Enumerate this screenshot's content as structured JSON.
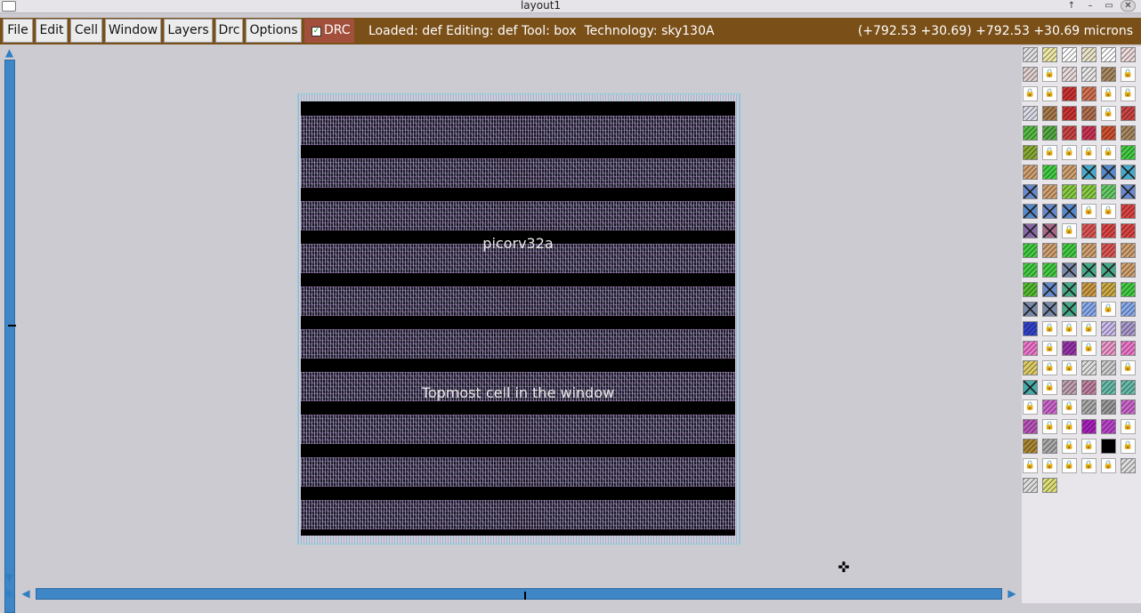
{
  "window": {
    "title": "layout1"
  },
  "menu": {
    "items": [
      "File",
      "Edit",
      "Cell",
      "Window",
      "Layers",
      "Drc",
      "Options"
    ],
    "drc_label": "DRC",
    "drc_checked": true
  },
  "status": {
    "text": "Loaded: def Editing: def Tool: box  Technology: sky130A",
    "coords": "(+792.53 +30.69) +792.53 +30.69 microns"
  },
  "canvas": {
    "cell_name": "picorv32a",
    "cell_caption": "Topmost cell in the window"
  },
  "colors": {
    "menubar": "#7a4f18",
    "drc": "#a24f3c",
    "scrollbar": "#3f86c6",
    "background": "#cdcbd2"
  },
  "layers_panel": {
    "rows": [
      [
        "#e0dfe2",
        "#eee8a6",
        "#ffffff",
        "#e8e2c8",
        "#ffffff",
        "#ecd8d8"
      ],
      [
        "#e0d0d0",
        "lock",
        "#e8dada",
        "#e6e6e6",
        "#a88860",
        "lock"
      ],
      [
        "lock",
        "lock",
        "#cc3333",
        "#d27050",
        "lock",
        "lock"
      ],
      [
        "#dcdce8",
        "#a87a4c",
        "#cc3333",
        "#b07050",
        "lock",
        "#cc4444"
      ],
      [
        "#55bb44",
        "#55aa44",
        "#cc4444",
        "#cc3355",
        "#d05030",
        "#a88860"
      ],
      [
        "#88aa33",
        "lock",
        "lock",
        "lock",
        "lock",
        "#44cc44"
      ],
      [
        "#d0a070",
        "#44cc44",
        "#d0a070",
        "x:#44aacc",
        "x:#5588cc",
        "x:#44aacc"
      ],
      [
        "x:#6688cc",
        "#d0a070",
        "#88cc44",
        "#88cc44",
        "#66cc66",
        "x:#6688cc"
      ],
      [
        "x:#5588cc",
        "x:#6688cc",
        "x:#5588cc",
        "lock",
        "lock",
        "#dd4444"
      ],
      [
        "x:#8866aa",
        "x:#aa6688",
        "lock",
        "#dd5555",
        "#dd4444",
        "#dd4444"
      ],
      [
        "#44cc44",
        "#d0a070",
        "#44cc44",
        "#d0a070",
        "#dd5555",
        "#d0a070"
      ],
      [
        "#44cc44",
        "#44cc44",
        "x:#7788aa",
        "x:#44aa88",
        "x:#44aa88",
        "#d0a070"
      ],
      [
        "#55bb33",
        "x:#6688cc",
        "x:#44aa88",
        "#cc9944",
        "#ccaa44",
        "#44cc44"
      ],
      [
        "x:#7788aa",
        "x:#7788aa",
        "x:#44aa88",
        "#88aaee",
        "lock",
        "#88aaee"
      ],
      [
        "#3344cc",
        "lock",
        "lock",
        "lock",
        "#ccbbee",
        "#aa99cc"
      ],
      [
        "#ee77cc",
        "lock",
        "#9933aa",
        "lock",
        "#ee99cc",
        "#ee77cc"
      ],
      [
        "#ddcc66",
        "lock",
        "lock",
        "#dddddd",
        "#cccccc",
        "lock"
      ],
      [
        "x:#44aaaa",
        "lock",
        "#c0a0b0",
        "#c080a0",
        "#66bbaa",
        "#66bbaa"
      ],
      [
        "lock",
        "#cc66cc",
        "lock",
        "#aaaaaa",
        "#999999",
        "#cc66cc"
      ],
      [
        "#bb55bb",
        "lock",
        "lock",
        "#aa22bb",
        "#bb44cc",
        "lock"
      ],
      [
        "#aa8833",
        "#aaaaaa",
        "lock",
        "lock",
        "#000000",
        "lock"
      ],
      [
        "lock",
        "lock",
        "lock",
        "lock",
        "lock",
        "#dddddd"
      ],
      [
        "#dddddd",
        "#dddd77"
      ]
    ]
  }
}
